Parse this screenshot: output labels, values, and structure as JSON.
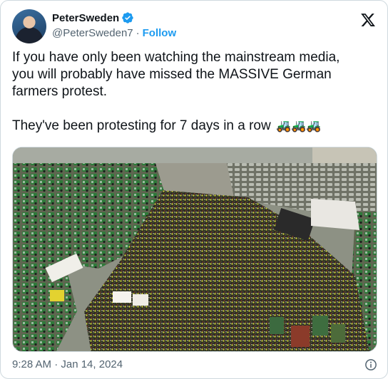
{
  "author": {
    "name": "PeterSweden",
    "handle": "@PeterSweden7",
    "separator": "·",
    "follow_label": "Follow",
    "verified": true
  },
  "post": {
    "line1": "If you have only been watching the mainstream media,",
    "line2": "you will probably have missed the MASSIVE German",
    "line3": "farmers protest.",
    "line5": "They've been protesting for 7 days in a row",
    "emoji": "🚜🚜🚜"
  },
  "footer": {
    "timestamp": "9:28 AM · Jan 14, 2024"
  },
  "colors": {
    "accent": "#1d9bf0",
    "text": "#0f1419",
    "muted": "#536471",
    "border": "#cfd9de"
  },
  "icons": [
    "verified-badge-icon",
    "x-logo-icon",
    "info-icon"
  ]
}
